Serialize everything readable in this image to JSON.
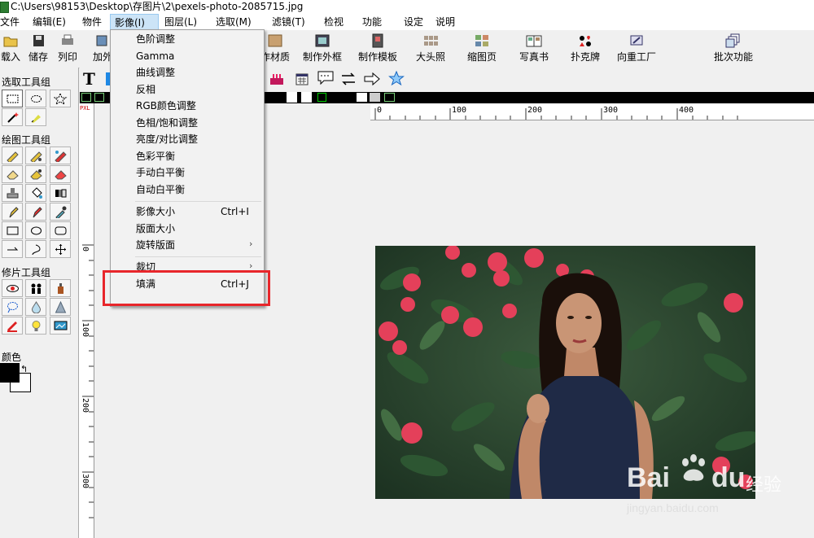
{
  "window": {
    "title": "C:\\Users\\98153\\Desktop\\存图片\\2\\pexels-photo-2085715.jpg"
  },
  "menubar": {
    "items": [
      "文件",
      "编辑(E)",
      "物件",
      "影像(I)",
      "图层(L)",
      "选取(M)",
      "滤镜(T)",
      "检视",
      "功能",
      "设定",
      "说明"
    ],
    "active_index": 3
  },
  "toolbar": {
    "buttons": [
      "载入",
      "储存",
      "列印",
      "加外",
      "作材质",
      "制作外框",
      "制作模板",
      "大头照",
      "缩图页",
      "写真书",
      "扑克牌",
      "向重工厂",
      "批次功能"
    ]
  },
  "image_menu": {
    "items": [
      {
        "label": "色阶调整",
        "shortcut": "",
        "submenu": false
      },
      {
        "label": "Gamma",
        "shortcut": "",
        "submenu": false
      },
      {
        "label": "曲线调整",
        "shortcut": "",
        "submenu": false
      },
      {
        "label": "反相",
        "shortcut": "",
        "submenu": false
      },
      {
        "label": "RGB颜色调整",
        "shortcut": "",
        "submenu": false
      },
      {
        "label": "色相/饱和调整",
        "shortcut": "",
        "submenu": false
      },
      {
        "label": "亮度/对比调整",
        "shortcut": "",
        "submenu": false
      },
      {
        "label": "色彩平衡",
        "shortcut": "",
        "submenu": false
      },
      {
        "label": "手动白平衡",
        "shortcut": "",
        "submenu": false
      },
      {
        "label": "自动白平衡",
        "shortcut": "",
        "submenu": false
      },
      {
        "label": "影像大小",
        "shortcut": "Ctrl+I",
        "submenu": false
      },
      {
        "label": "版面大小",
        "shortcut": "",
        "submenu": false
      },
      {
        "label": "旋转版面",
        "shortcut": "",
        "submenu": true
      },
      {
        "label": "裁切",
        "shortcut": "",
        "submenu": true
      },
      {
        "label": "填满",
        "shortcut": "Ctrl+J",
        "submenu": false
      }
    ],
    "submenu_arrow": "›",
    "highlighted_item": "填满"
  },
  "left_panel": {
    "groups": [
      "选取工具组",
      "绘图工具组",
      "修片工具组",
      "颜色"
    ],
    "swap_glyph": "↰"
  },
  "rulers": {
    "top_labels": [
      "0",
      "100",
      "200",
      "300",
      "400"
    ],
    "left_labels": [
      "0",
      "100",
      "200",
      "300"
    ],
    "unit_badge": "PXL"
  },
  "text_tool_glyph": "T",
  "watermark": {
    "brand": "Bai",
    "brand2": "du",
    "cn": "经验",
    "url": "jingyan.baidu.com"
  },
  "colors": {
    "accent_highlight": "#cce4f7",
    "annotation_red": "#e8262b",
    "foreground": "#000000",
    "background": "#ffffff"
  }
}
